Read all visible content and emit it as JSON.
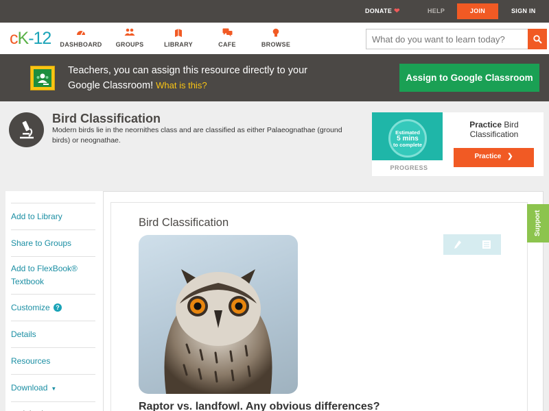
{
  "topbar": {
    "donate": "DONATE",
    "help": "HELP",
    "join": "JOIN",
    "sign_in": "SIGN IN"
  },
  "nav": {
    "logo_c": "c",
    "logo_k": "K",
    "logo_n": "-12",
    "items": [
      {
        "label": "DASHBOARD",
        "icon": "dashboard-icon"
      },
      {
        "label": "GROUPS",
        "icon": "groups-icon"
      },
      {
        "label": "LIBRARY",
        "icon": "library-icon"
      },
      {
        "label": "CAFE",
        "icon": "cafe-icon"
      },
      {
        "label": "BROWSE",
        "icon": "browse-icon"
      }
    ],
    "search_placeholder": "What do you want to learn today?"
  },
  "banner": {
    "text": "Teachers, you can assign this resource directly to your Google Classroom!",
    "link": "What is this?",
    "button": "Assign to Google Classroom"
  },
  "concept": {
    "title": "Bird Classification",
    "description": "Modern birds lie in the neornithes class and are classified as either Palaeognathae (ground birds) or neognathae."
  },
  "practice": {
    "estimated": "Estimated",
    "mins": "5 mins",
    "to_complete": "to complete",
    "progress": "PROGRESS",
    "title_bold": "Practice",
    "title_rest": "Bird Classification",
    "button": "Practice"
  },
  "sidebar": {
    "items": [
      "Add to Library",
      "Share to Groups",
      "Add to FlexBook® Textbook",
      "Customize",
      "Details",
      "Resources",
      "Download"
    ],
    "quick_tips": "Quick Tips"
  },
  "article": {
    "title": "Bird Classification",
    "subtitle": "Raptor vs. landfowl. Any obvious differences?"
  },
  "support": "Support",
  "colors": {
    "accent": "#f15a24",
    "teal": "#1aa3b7",
    "green": "#1aa054",
    "dark": "#4b4845"
  }
}
